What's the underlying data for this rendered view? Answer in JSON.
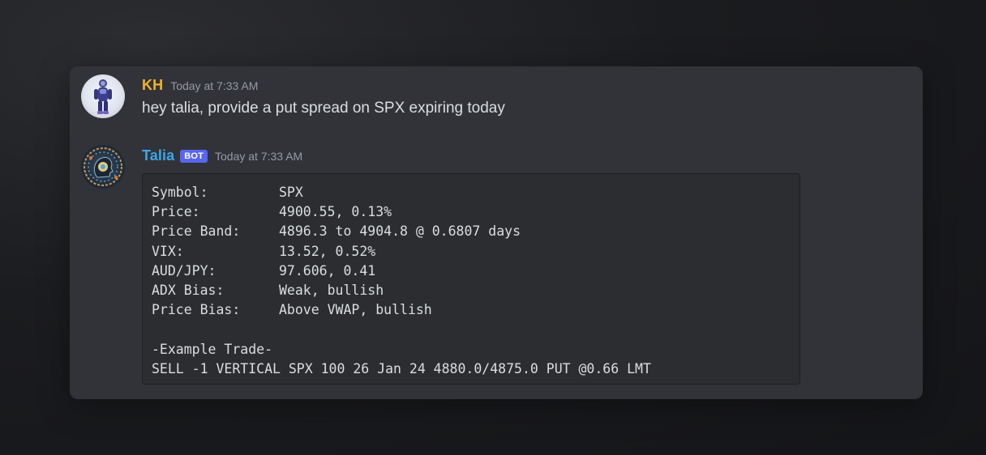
{
  "messages": [
    {
      "author": "KH",
      "author_color": "#f0b232",
      "timestamp": "Today at 7:33 AM",
      "text": "hey talia, provide a put spread on SPX expiring today"
    },
    {
      "author": "Talia",
      "author_color": "#3ea6e8",
      "badge": "BOT",
      "timestamp": "Today at 7:33 AM",
      "code": {
        "rows": [
          {
            "key": "Symbol:",
            "value": "SPX"
          },
          {
            "key": "Price:",
            "value": "4900.55, 0.13%"
          },
          {
            "key": "Price Band:",
            "value": "4896.3 to 4904.8 @ 0.6807 days"
          },
          {
            "key": "VIX:",
            "value": "13.52, 0.52%"
          },
          {
            "key": "AUD/JPY:",
            "value": "97.606, 0.41"
          },
          {
            "key": "ADX Bias:",
            "value": "Weak, bullish"
          },
          {
            "key": "Price Bias:",
            "value": "Above VWAP, bullish"
          }
        ],
        "trade_heading": "-Example Trade-",
        "trade_line": "SELL -1 VERTICAL SPX 100 26 Jan 24 4880.0/4875.0 PUT @0.66 LMT"
      }
    }
  ]
}
